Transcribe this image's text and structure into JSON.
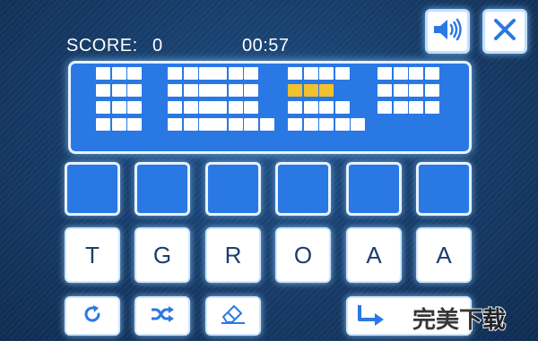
{
  "hud": {
    "score_label": "SCORE:",
    "score_value": "0",
    "timer": "00:57"
  },
  "top_buttons": {
    "sound_icon": "speaker-icon",
    "close_icon": "close-icon"
  },
  "answer_slots": [
    "",
    "",
    "",
    "",
    "",
    ""
  ],
  "letter_tiles": [
    "T",
    "G",
    "R",
    "O",
    "A",
    "A"
  ],
  "toolbar": {
    "refresh_icon": "refresh-icon",
    "shuffle_icon": "shuffle-icon",
    "eraser_icon": "eraser-icon",
    "submit_icon": "enter-arrow-icon"
  },
  "watermark": {
    "text": "完美下载"
  },
  "colors": {
    "accent_blue": "#2a78e4",
    "highlight_yellow": "#f2c12e",
    "tile_text": "#1b3d70"
  }
}
